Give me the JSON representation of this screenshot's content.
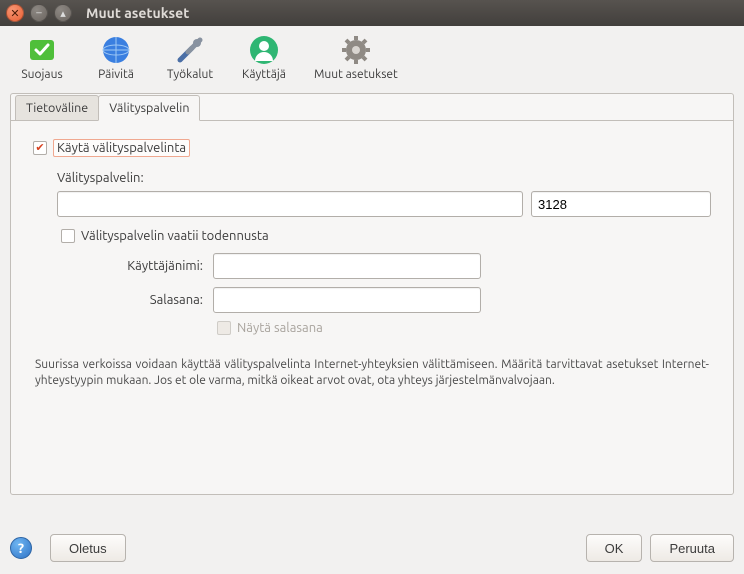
{
  "window": {
    "title": "Muut asetukset"
  },
  "toolbar": {
    "protection": "Suojaus",
    "update": "Päivitä",
    "tools": "Työkalut",
    "user": "Käyttäjä",
    "other": "Muut asetukset"
  },
  "tabs": {
    "medium": "Tietoväline",
    "proxy": "Välityspalvelin"
  },
  "proxy": {
    "use_proxy_label": "Käytä välityspalvelinta",
    "server_label": "Välityspalvelin:",
    "host_value": "",
    "port_value": "3128",
    "requires_auth_label": "Välityspalvelin vaatii todennusta",
    "username_label": "Käyttäjänimi:",
    "username_value": "",
    "password_label": "Salasana:",
    "password_value": "",
    "show_password_label": "Näytä salasana",
    "help_text": "Suurissa verkoissa voidaan käyttää välityspalvelinta Internet-yhteyksien välittämiseen. Määritä tarvittavat asetukset Internet-yhteystyypin mukaan. Jos et ole varma, mitkä oikeat arvot ovat, ota yhteys järjestelmänvalvojaan."
  },
  "footer": {
    "defaults": "Oletus",
    "ok": "OK",
    "cancel": "Peruuta"
  }
}
